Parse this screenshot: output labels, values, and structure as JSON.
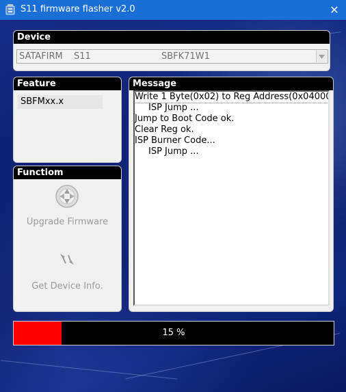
{
  "window": {
    "title": "S11 firmware flasher v2.0",
    "close_glyph": "✕",
    "app_icon": "flasher-app-icon"
  },
  "device": {
    "header": "Device",
    "selected": {
      "vendor": "SATAFIRM",
      "model": "S11",
      "firmware": "SBFK71W1"
    }
  },
  "feature": {
    "header": "Feature",
    "items": [
      "SBFMxx.x"
    ]
  },
  "function": {
    "header": "Functiom",
    "buttons": [
      {
        "label": "Upgrade Firmware",
        "icon": "upgrade-firmware-icon"
      },
      {
        "label": "Get Device Info.",
        "icon": "device-info-icon"
      }
    ]
  },
  "message": {
    "header": "Message",
    "lines": [
      {
        "text": "Write 1 Byte(0x02) to Reg Address(0x04000",
        "indent": false,
        "selected": true
      },
      {
        "text": "ISP Jump ...",
        "indent": true,
        "selected": false
      },
      {
        "text": "Jump to Boot Code ok.",
        "indent": false,
        "selected": false
      },
      {
        "text": "Clear Reg ok.",
        "indent": false,
        "selected": false
      },
      {
        "text": "ISP Burner Code...",
        "indent": false,
        "selected": false
      },
      {
        "text": "ISP Jump ...",
        "indent": true,
        "selected": false
      }
    ]
  },
  "progress": {
    "percent": 15,
    "label": "15 %",
    "fill_color": "#ff0000"
  },
  "colors": {
    "titlebar": "#1a6fd6",
    "panel_header": "#000000",
    "panel_bg": "#f0f0f0"
  }
}
